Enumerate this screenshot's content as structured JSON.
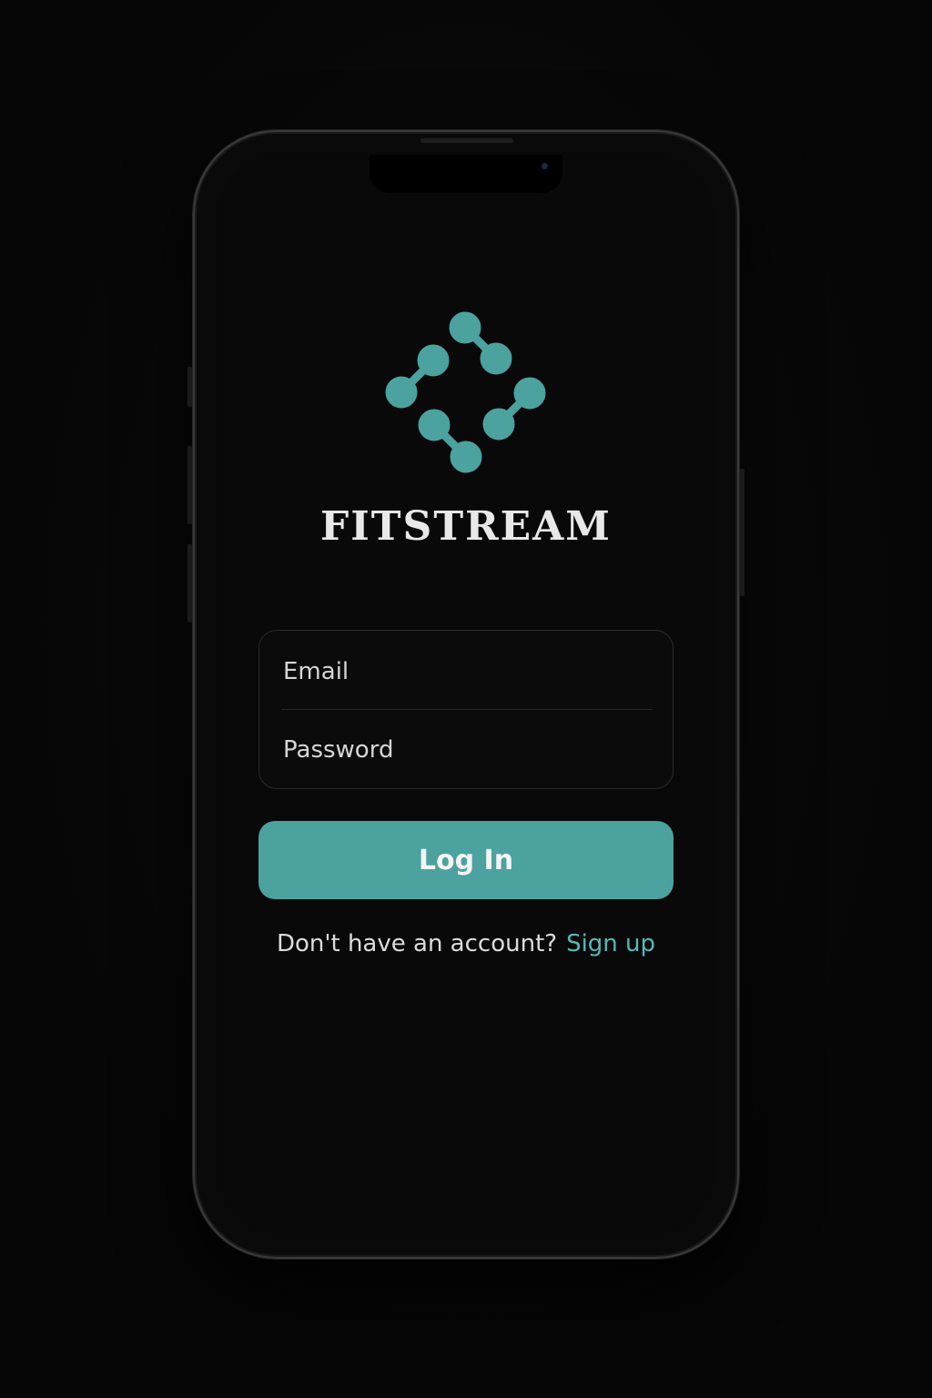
{
  "app": {
    "brand_name": "FITSTREAM",
    "accent_color": "#4ba29f",
    "link_color": "#58b8b6",
    "logo_icon": "dumbbell-diamond-icon"
  },
  "login_form": {
    "email_placeholder": "Email",
    "password_placeholder": "Password",
    "email_value": "",
    "password_value": ""
  },
  "actions": {
    "login_label": "Log In",
    "signup_prompt": "Don't have an account?",
    "signup_link": "Sign up"
  }
}
